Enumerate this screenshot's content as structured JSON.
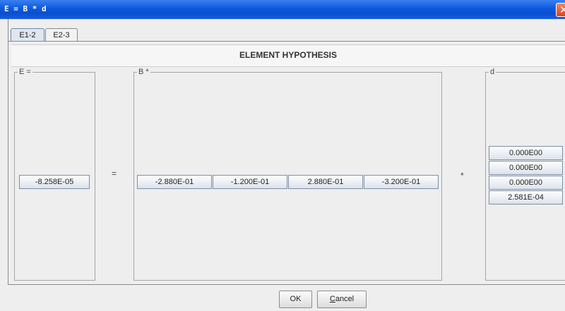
{
  "window": {
    "title": "E = B * d"
  },
  "tabs": [
    {
      "label": "E1-2",
      "active": true
    },
    {
      "label": "E2-3",
      "active": false
    }
  ],
  "header": {
    "title": "ELEMENT HYPOTHESIS"
  },
  "groups": {
    "e": {
      "legend": "E =",
      "value": "-8.258E-05"
    },
    "b": {
      "legend": "B *",
      "values": [
        "-2.880E-01",
        "-1.200E-01",
        "2.880E-01",
        "-3.200E-01"
      ]
    },
    "d": {
      "legend": "d",
      "values": [
        "0.000E00",
        "0.000E00",
        "0.000E00",
        "2.581E-04"
      ]
    }
  },
  "operators": {
    "equals": "=",
    "times": "*"
  },
  "buttons": {
    "ok": "OK",
    "cancel_mnemonic": "C",
    "cancel_rest": "ancel"
  },
  "colors": {
    "titlebar": "#0b59e0",
    "close": "#d7421e"
  }
}
